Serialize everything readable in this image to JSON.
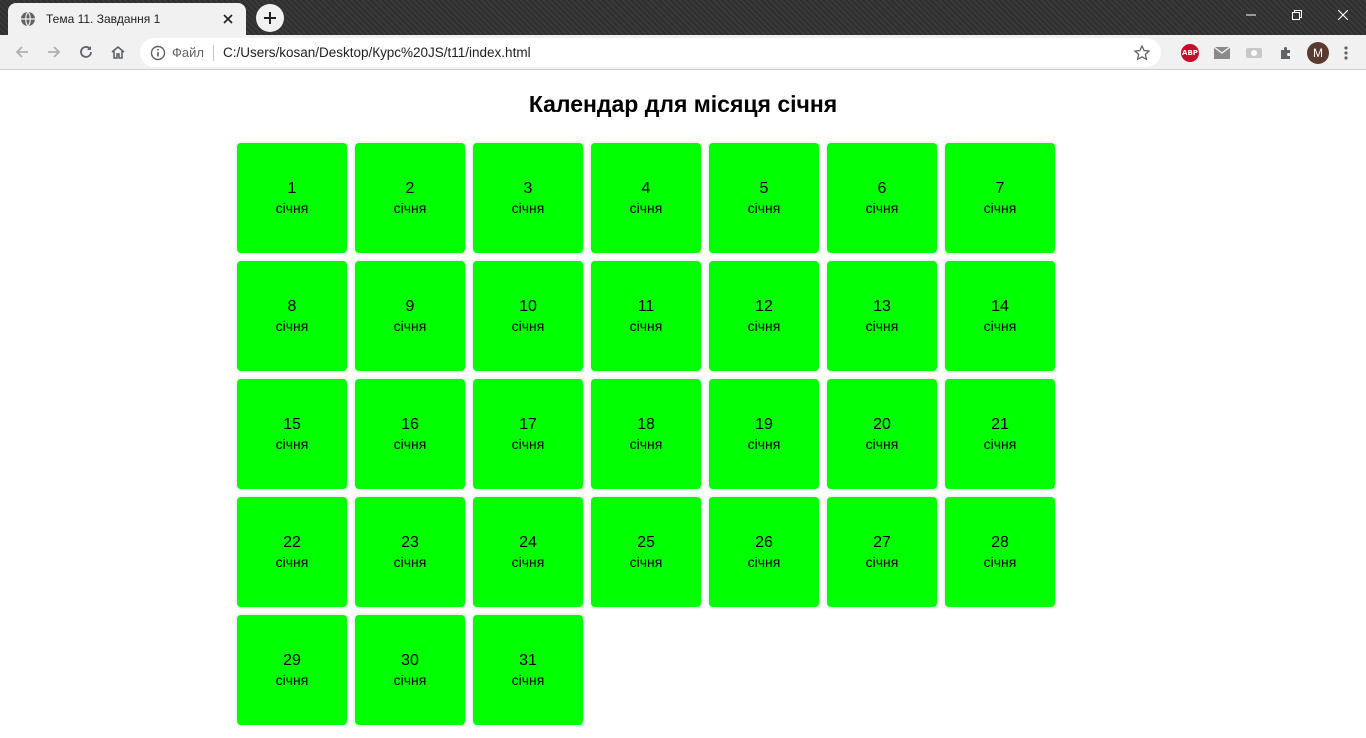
{
  "browser": {
    "tab_title": "Тема 11. Завдання 1",
    "scheme_label": "Файл",
    "url": "C:/Users/kosan/Desktop/Курс%20JS/t11/index.html",
    "avatar_letter": "M",
    "abp_label": "ABP"
  },
  "page": {
    "heading": "Календар для місяця січня"
  },
  "calendar": {
    "days": [
      {
        "day": "1",
        "month": "січня"
      },
      {
        "day": "2",
        "month": "січня"
      },
      {
        "day": "3",
        "month": "січня"
      },
      {
        "day": "4",
        "month": "січня"
      },
      {
        "day": "5",
        "month": "січня"
      },
      {
        "day": "6",
        "month": "січня"
      },
      {
        "day": "7",
        "month": "січня"
      },
      {
        "day": "8",
        "month": "січня"
      },
      {
        "day": "9",
        "month": "січня"
      },
      {
        "day": "10",
        "month": "січня"
      },
      {
        "day": "11",
        "month": "січня"
      },
      {
        "day": "12",
        "month": "січня"
      },
      {
        "day": "13",
        "month": "січня"
      },
      {
        "day": "14",
        "month": "січня"
      },
      {
        "day": "15",
        "month": "січня"
      },
      {
        "day": "16",
        "month": "січня"
      },
      {
        "day": "17",
        "month": "січня"
      },
      {
        "day": "18",
        "month": "січня"
      },
      {
        "day": "19",
        "month": "січня"
      },
      {
        "day": "20",
        "month": "січня"
      },
      {
        "day": "21",
        "month": "січня"
      },
      {
        "day": "22",
        "month": "січня"
      },
      {
        "day": "23",
        "month": "січня"
      },
      {
        "day": "24",
        "month": "січня"
      },
      {
        "day": "25",
        "month": "січня"
      },
      {
        "day": "26",
        "month": "січня"
      },
      {
        "day": "27",
        "month": "січня"
      },
      {
        "day": "28",
        "month": "січня"
      },
      {
        "day": "29",
        "month": "січня"
      },
      {
        "day": "30",
        "month": "січня"
      },
      {
        "day": "31",
        "month": "січня"
      }
    ]
  },
  "colors": {
    "day_cell": "#00ff00",
    "chrome_toolbar": "#f1f1f1"
  }
}
